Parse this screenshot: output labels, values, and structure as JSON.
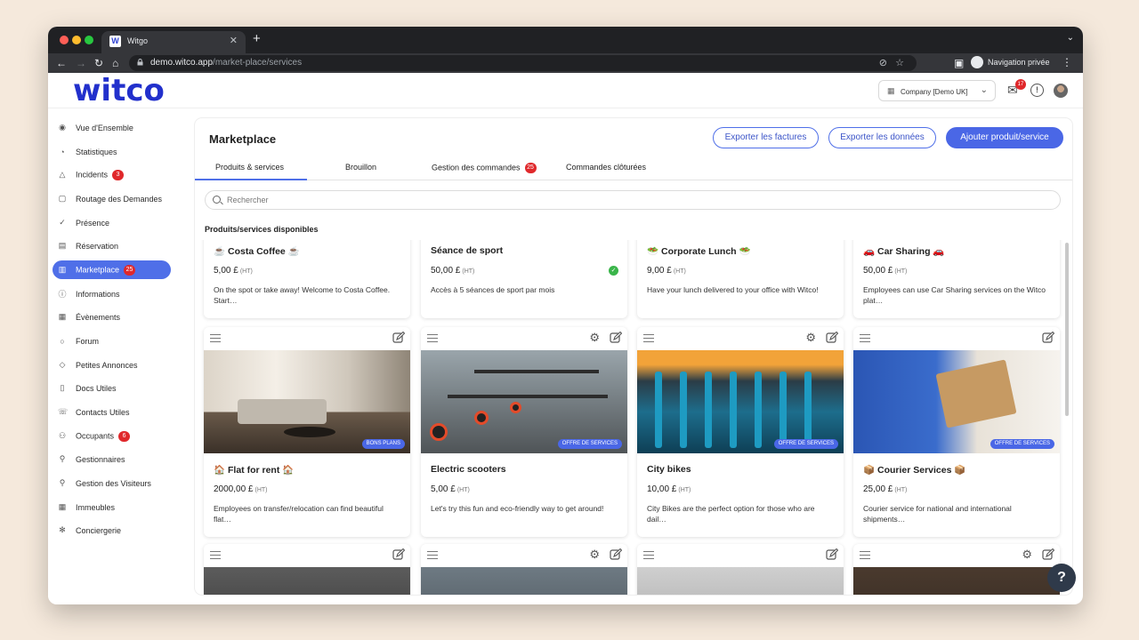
{
  "browser": {
    "tab_title": "Witgo",
    "tab_favicon": "W",
    "url_host": "demo.witco.app",
    "url_path": "/market-place/services",
    "private_label": "Navigation privée"
  },
  "header": {
    "logo": "witco",
    "company": "Company [Demo UK]",
    "mail_count": "17"
  },
  "sidebar": {
    "items": [
      {
        "label": "Vue d'Ensemble",
        "icon": "eye-icon"
      },
      {
        "label": "Statistiques",
        "icon": "chart-icon"
      },
      {
        "label": "Incidents",
        "icon": "warning-icon",
        "badge": "3"
      },
      {
        "label": "Routage des Demandes",
        "icon": "routing-icon"
      },
      {
        "label": "Présence",
        "icon": "check-circle-icon"
      },
      {
        "label": "Réservation",
        "icon": "calendar-icon"
      },
      {
        "label": "Marketplace",
        "icon": "store-icon",
        "badge": "25",
        "active": true
      },
      {
        "label": "Informations",
        "icon": "info-icon"
      },
      {
        "label": "Évènements",
        "icon": "event-icon"
      },
      {
        "label": "Forum",
        "icon": "chat-icon"
      },
      {
        "label": "Petites Annonces",
        "icon": "tag-icon"
      },
      {
        "label": "Docs Utiles",
        "icon": "document-icon"
      },
      {
        "label": "Contacts Utiles",
        "icon": "phone-icon"
      },
      {
        "label": "Occupants",
        "icon": "users-icon",
        "badge": "6"
      },
      {
        "label": "Gestionnaires",
        "icon": "user-icon"
      },
      {
        "label": "Gestion des Visiteurs",
        "icon": "visitor-icon"
      },
      {
        "label": "Immeubles",
        "icon": "building-icon"
      },
      {
        "label": "Conciergerie",
        "icon": "concierge-icon"
      }
    ]
  },
  "main": {
    "title": "Marketplace",
    "buttons": {
      "export_invoices": "Exporter les factures",
      "export_data": "Exporter les données",
      "add_product": "Ajouter produit/service"
    },
    "tabs": [
      {
        "label": "Produits & services",
        "active": true
      },
      {
        "label": "Brouillon"
      },
      {
        "label": "Gestion des commandes",
        "badge": "25"
      },
      {
        "label": "Commandes clôturées"
      }
    ],
    "search_placeholder": "Rechercher",
    "section_title": "Produits/services disponibles",
    "cards_row1": [
      {
        "title": "☕ Costa Coffee ☕",
        "price": "5,00 £",
        "ht": "(HT)",
        "desc": "On the spot or take away! Welcome to Costa Coffee. Start…"
      },
      {
        "title": "Séance de sport",
        "price": "50,00 £",
        "ht": "(HT)",
        "desc": "Accès à 5 séances de sport par mois",
        "check": true
      },
      {
        "title": "🥗 Corporate Lunch 🥗",
        "price": "9,00 £",
        "ht": "(HT)",
        "desc": "Have your lunch delivered to your office with Witco!"
      },
      {
        "title": "🚗 Car Sharing 🚗",
        "price": "50,00 £",
        "ht": "(HT)",
        "desc": "Employees can use Car Sharing services on the Witco plat…"
      }
    ],
    "cards_row2": [
      {
        "title": "🏠 Flat for rent 🏠",
        "price": "2000,00 £",
        "ht": "(HT)",
        "desc": "Employees on transfer/relocation can find beautiful flat…",
        "badge": "BONS PLANS",
        "image": "flat"
      },
      {
        "title": "Electric scooters",
        "price": "5,00 £",
        "ht": "(HT)",
        "desc": "Let's try this fun and eco-friendly way to get around!",
        "badge": "OFFRE DE SERVICES",
        "image": "scooters"
      },
      {
        "title": "City bikes",
        "price": "10,00 £",
        "ht": "(HT)",
        "desc": "City Bikes are the perfect option for those who are dail…",
        "badge": "OFFRE DE SERVICES",
        "image": "bikes"
      },
      {
        "title": "📦 Courier Services 📦",
        "price": "25,00 £",
        "ht": "(HT)",
        "desc": "Courier service for national and international shipments…",
        "badge": "OFFRE DE SERVICES",
        "image": "courier"
      }
    ]
  },
  "help_label": "?"
}
